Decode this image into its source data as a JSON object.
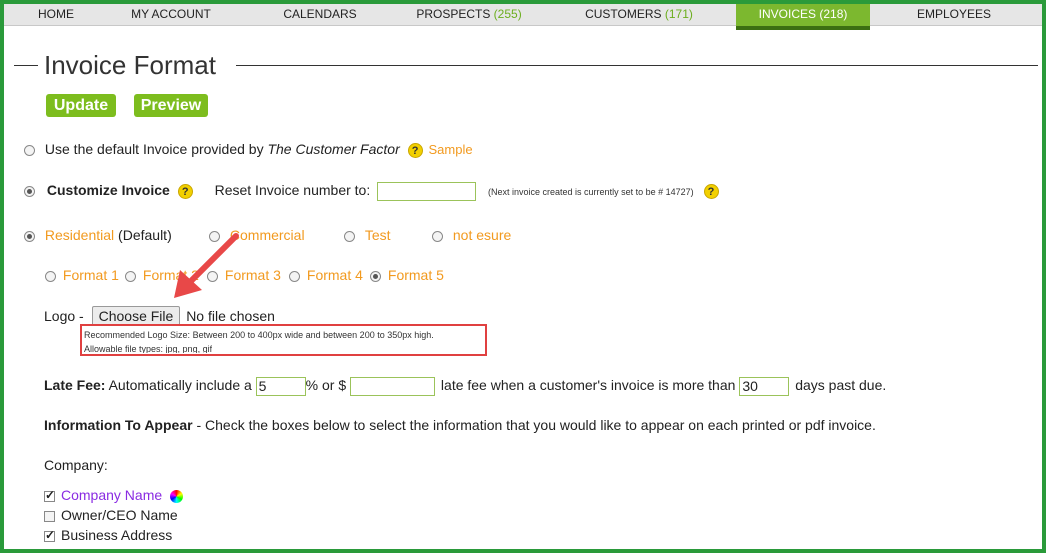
{
  "nav": {
    "home": "HOME",
    "account": "MY ACCOUNT",
    "calendars": "CALENDARS",
    "prospects": "PROSPECTS",
    "prospects_count": "(255)",
    "customers": "CUSTOMERS",
    "customers_count": "(171)",
    "invoices": "INVOICES",
    "invoices_count": "(218)",
    "employees": "EMPLOYEES"
  },
  "page": {
    "title": "Invoice Format",
    "update_label": "Update",
    "preview_label": "Preview"
  },
  "default_invoice": {
    "text": "Use the default Invoice provided by ",
    "company": "The Customer Factor",
    "sample": "Sample"
  },
  "customize": {
    "label": "Customize Invoice",
    "reset_label": "Reset Invoice number to:",
    "reset_value": "",
    "note": "(Next invoice created is currently set to be # 14727)"
  },
  "types": {
    "residential": "Residential",
    "default_note": "(Default)",
    "commercial": "Commercial",
    "test": "Test",
    "not_esure": "not esure"
  },
  "formats": [
    "Format 1",
    "Format 2",
    "Format 3",
    "Format 4",
    "Format 5"
  ],
  "logo": {
    "label": "Logo -",
    "choose_file": "Choose File",
    "no_file": "No file chosen",
    "recommended": "Recommended Logo Size: Between 200 to 400px wide and between 200 to 350px high.",
    "allowable": "Allowable file types: jpg, png, gif"
  },
  "late_fee": {
    "label": "Late Fee:",
    "text1": "Automatically include a",
    "percent_value": "5",
    "text2": "% or $",
    "dollar_value": "",
    "text3": "late fee when a customer's invoice is more than",
    "days_value": "30",
    "text4": "days past due."
  },
  "info": {
    "label": "Information To Appear",
    "text": "- Check the boxes below to select the information that you would like to appear on each printed or pdf invoice."
  },
  "company": {
    "heading": "Company:",
    "items": [
      "Company Name",
      "Owner/CEO Name",
      "Business Address"
    ]
  },
  "colors": {
    "accent": "#7dbd1e",
    "orange": "#f29a1f",
    "frame": "#2a9a3a"
  }
}
